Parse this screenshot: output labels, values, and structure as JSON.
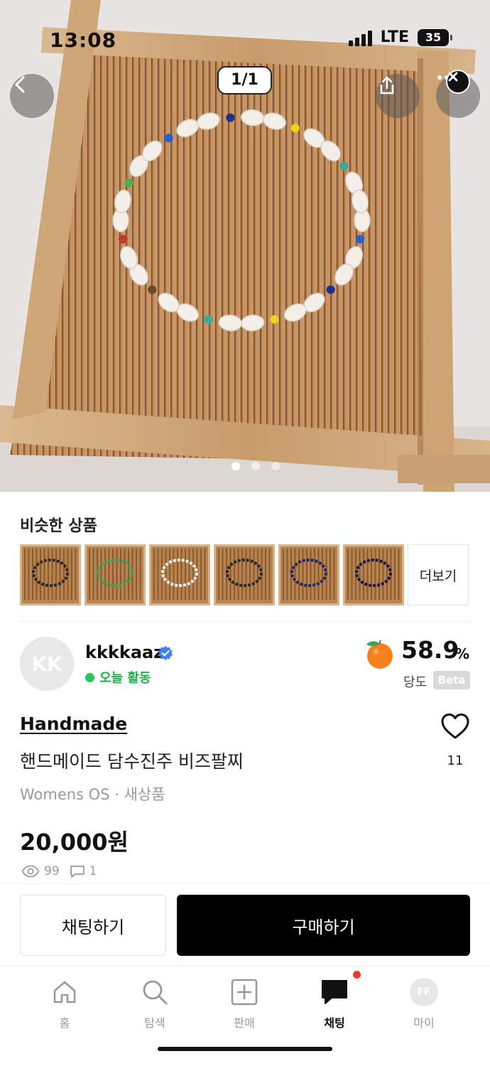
{
  "status_bar": {
    "time": "13:08",
    "network": "LTE",
    "battery": "35"
  },
  "gallery": {
    "counter": "1/1",
    "page_count": 3,
    "active_page": 0
  },
  "similar": {
    "title": "비슷한 상품",
    "more_label": "더보기",
    "thumb_count": 6
  },
  "seller": {
    "avatar_initials": "KK",
    "name": "kkkkaaz",
    "activity": "오늘 활동",
    "sweetness_value": "58.9",
    "sweetness_unit": "%",
    "sweetness_label": "당도",
    "beta": "Beta"
  },
  "product": {
    "brand": "Handmade",
    "title": "핸드메이드 담수진주 비즈팔찌",
    "meta": "Womens OS · 새상품",
    "price": "20,000원",
    "likes": "11",
    "views": "99",
    "chats": "1"
  },
  "actions": {
    "chat": "채팅하기",
    "buy": "구매하기"
  },
  "tabs": [
    {
      "label": "홈"
    },
    {
      "label": "탐색"
    },
    {
      "label": "판매"
    },
    {
      "label": "채팅"
    },
    {
      "label": "마이",
      "avatar": "FF"
    }
  ],
  "colors": {
    "accent_green": "#22c55e",
    "buy_button": "#000000",
    "notification": "#f03a2e",
    "tangerine": "#f5821f"
  }
}
